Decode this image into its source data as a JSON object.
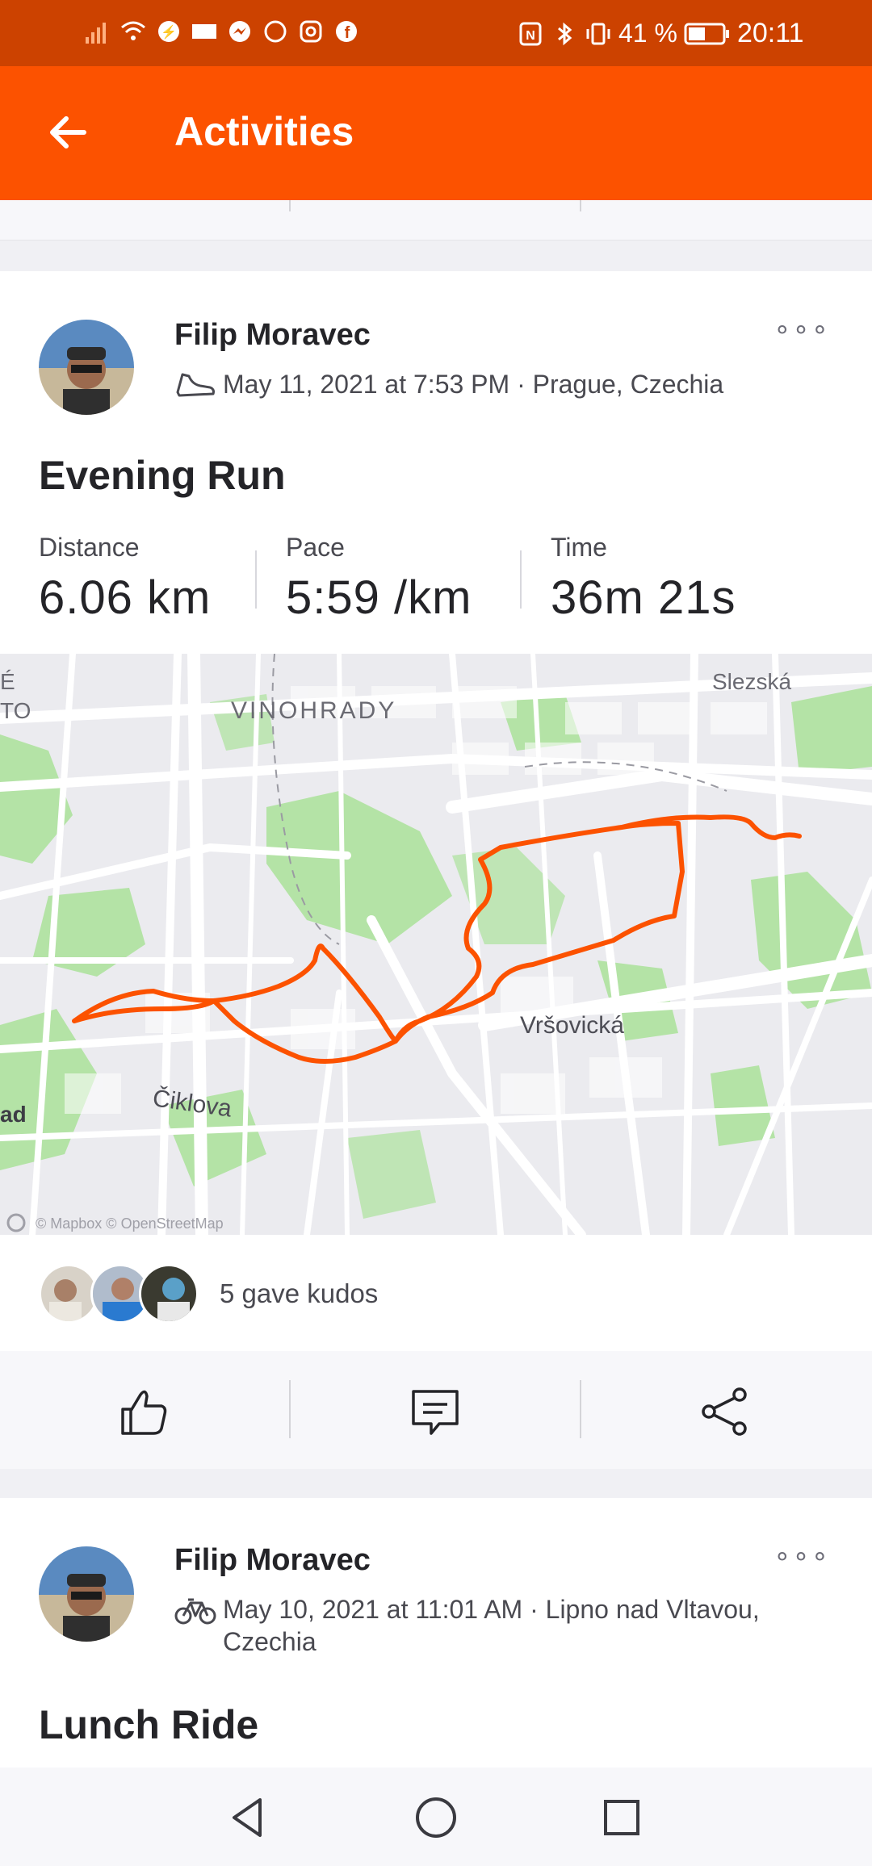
{
  "status_bar": {
    "battery_text": "41 %",
    "time": "20:11",
    "colors": {
      "background": "#cc4200"
    }
  },
  "app_bar": {
    "title": "Activities",
    "back_icon": "arrow-left-icon",
    "colors": {
      "background": "#fc5200"
    }
  },
  "activities": [
    {
      "athlete": "Filip Moravec",
      "sport_icon": "running-shoe-icon",
      "date_location": "May 11, 2021 at 7:53 PM · Prague, Czechia",
      "title": "Evening Run",
      "stats": [
        {
          "label": "Distance",
          "value": "6.06 km"
        },
        {
          "label": "Pace",
          "value": "5:59 /km"
        },
        {
          "label": "Time",
          "value": "36m 21s"
        }
      ],
      "map": {
        "labels": [
          "Slezská",
          "VINOHRADY",
          "Vršovická",
          "Čiklova",
          "ad",
          "É",
          "TO"
        ],
        "attribution": "© Mapbox © OpenStreetMap",
        "route_color": "#fc5200"
      },
      "kudos_text": "5 gave kudos",
      "actions": [
        "thumbs-up-icon",
        "comment-icon",
        "share-icon"
      ]
    },
    {
      "athlete": "Filip Moravec",
      "sport_icon": "bicycle-icon",
      "date_location_line1": "May 10, 2021 at 11:01 AM · Lipno nad Vltavou,",
      "date_location_line2": "Czechia",
      "title": "Lunch Ride"
    }
  ],
  "more_label": "∘∘∘",
  "nav_bar": [
    "back-triangle-icon",
    "home-circle-icon",
    "recents-square-icon"
  ]
}
